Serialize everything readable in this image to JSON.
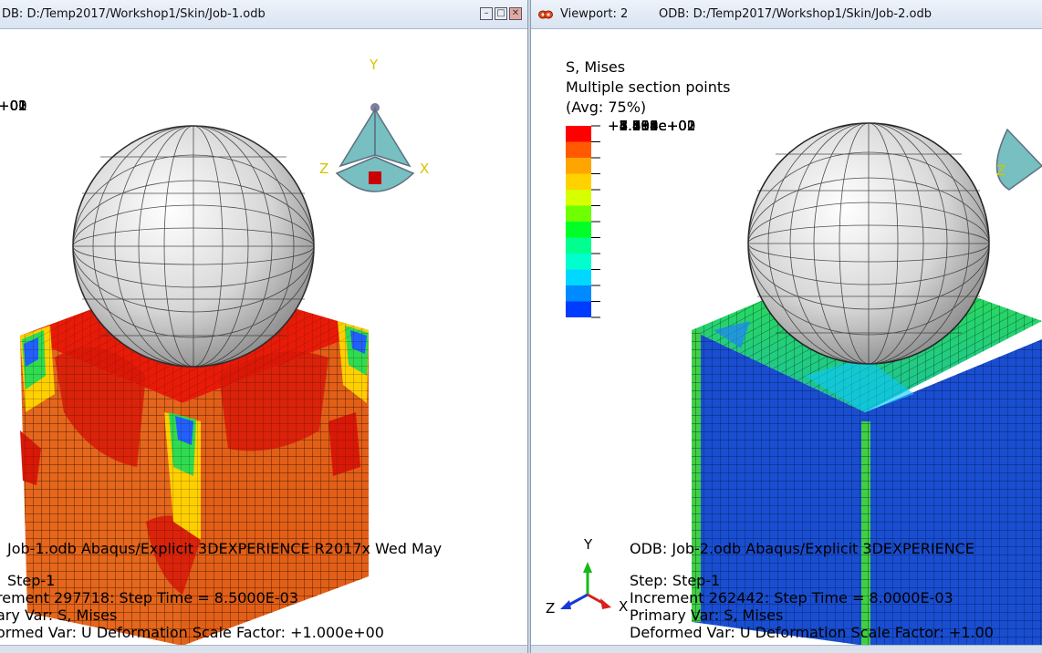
{
  "viewport_left": {
    "title": "DB: D:/Temp2017/Workshop1/Skin/Job-1.odb",
    "legend_values": [
      "+02",
      "+02",
      "+01",
      "+01",
      "+01",
      "+01",
      "+01",
      "+01",
      "+01",
      "+01",
      "+01",
      "+01",
      "+00"
    ],
    "triad": {
      "y": "Y",
      "z": "Z",
      "x": "X"
    },
    "info_line1": "Job-1.odb   Abaqus/Explicit 3DEXPERIENCE R2017x    Wed May",
    "info_step": "Step-1",
    "info_increment": "rement    297718: Step Time =    8.5000E-03",
    "info_primary": "ary Var: S, Mises",
    "info_deformed": "ormed Var: U   Deformation Scale Factor: +1.000e+00"
  },
  "viewport_right": {
    "icon": "viewport-icon",
    "title_label": "Viewport: 2",
    "title_odb": "ODB: D:/Temp2017/Workshop1/Skin/Job-2.odb",
    "legend_title1": "S, Mises",
    "legend_title2": "Multiple section points",
    "legend_title3": "(Avg: 75%)",
    "legend_values": [
      "+8.514e+02",
      "+7.812e+02",
      "+7.109e+02",
      "+6.406e+02",
      "+5.704e+02",
      "+5.001e+02",
      "+4.298e+02",
      "+3.596e+02",
      "+2.893e+02",
      "+2.190e+02",
      "+1.488e+02",
      "+7.850e+01",
      "+8.233e+00"
    ],
    "legend_colors": [
      "#ff0000",
      "#ff5a00",
      "#ffa500",
      "#ffd200",
      "#d7ff00",
      "#6eff00",
      "#00ff26",
      "#00ff8e",
      "#00ffcd",
      "#00d8ff",
      "#008aff",
      "#003cff",
      "#0000ff"
    ],
    "triad": {
      "y": "Y",
      "z": "Z",
      "x": "X"
    },
    "info_line1": "ODB: Job-2.odb    Abaqus/Explicit 3DEXPERIENCE",
    "info_step": "Step: Step-1",
    "info_increment": "Increment    262442: Step Time =    8.0000E-03",
    "info_primary": "Primary Var: S, Mises",
    "info_deformed": "Deformed Var: U   Deformation Scale Factor: +1.00"
  }
}
